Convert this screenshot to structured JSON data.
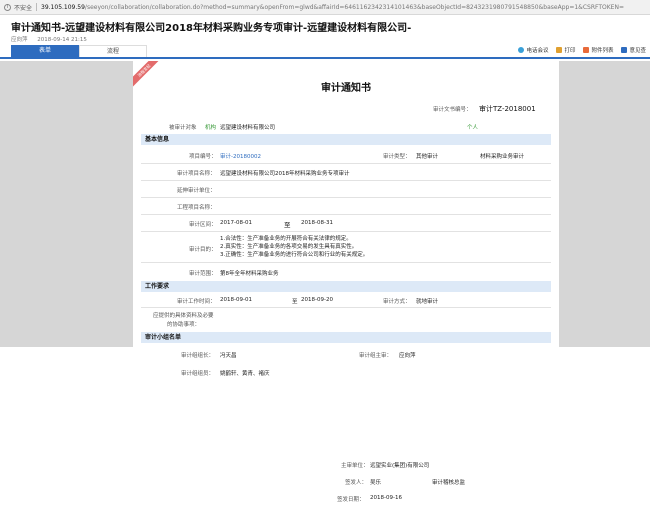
{
  "browser": {
    "security_label": "不安全",
    "url_host": "39.105.109.59",
    "url_path": "/seeyon/collaboration/collaboration.do?method=summary&openFrom=glwd&affairId=6461162342314101463&baseObjectId=8243231980791548850&baseApp=1&CSRFTOKEN="
  },
  "window": {
    "title": "审计通知书-远望建设材料有限公司2018年材料采购业务专项审计-远望建设材料有限公司-",
    "author": "应向萍",
    "datetime": "2018-09-14 21:15"
  },
  "tabs": {
    "form": "表单",
    "flow": "流程"
  },
  "actions": [
    {
      "label": "电话会议",
      "icon": "phone-icon",
      "color": "#3aa0d8"
    },
    {
      "label": "打印",
      "icon": "print-icon",
      "color": "#e0a030"
    },
    {
      "label": "附件列表",
      "icon": "attachment-icon",
      "color": "#e86a3a"
    },
    {
      "label": "意见查",
      "icon": "comment-icon",
      "color": "#2e6cbf"
    }
  ],
  "document": {
    "ribbon": "流程发起",
    "title": "审计通知书",
    "doc_no_label": "审计文书编号：",
    "doc_no": "审计TZ-2018001",
    "audited_label": "被审计对象",
    "audited_type": "机构",
    "audited_value": "远望建设材料有限公司",
    "audited_person": "个人",
    "sections": {
      "basic": "基本信息",
      "work": "工作要求",
      "team": "审计小组名单"
    },
    "basic": {
      "project_no_label": "项目编号：",
      "project_no": "审计-20180002",
      "audit_type_label": "审计类型：",
      "audit_type": "其他审计",
      "audit_type_value": "材料采购业务审计",
      "project_name_label": "审计项目名称：",
      "project_name": "远望建设材料有限公司2018年材料采购业务专项审计",
      "construction_unit_label": "延伸审计单位：",
      "engineering_label": "工程项目名称：",
      "period_label": "审计区间：",
      "period_start": "2017-08-01",
      "period_to": "至",
      "period_end": "2018-08-31",
      "purpose_label": "审计目的：",
      "purpose_lines": [
        "1.合法性：生产准备业务的开展符合有关法律的规定。",
        "2.真实性：生产准备业务的各项交易的发生具有真实性。",
        "3.正确性：生产准备业务的进行符合公司和行业的有关规定。"
      ],
      "scope_label": "审计范围：",
      "scope": "第8年全年材料采购业务"
    },
    "work": {
      "work_time_label": "审计工作时间：",
      "work_start": "2018-09-01",
      "work_to": "至",
      "work_end": "2018-09-20",
      "method_label": "审计方式：",
      "method": "就地审计",
      "materials_label_1": "应提供的具体资料及必要",
      "materials_label_2": "的协助事项："
    },
    "team": {
      "leader_label": "审计组组长：",
      "leader": "冯天昌",
      "chief_label": "审计组主审：",
      "chief": "应向萍",
      "members_label": "审计组组员：",
      "members": "姚鹤轩、黄青、褚庆"
    },
    "footer": {
      "host_label": "主审单位：",
      "host": "远望实业(集团)有限公司",
      "issuer_label": "签发人：",
      "issuer": "吴乐",
      "issuer_title": "审计稽核总监",
      "issue_date_label": "签发日期：",
      "issue_date": "2018-09-16"
    }
  }
}
